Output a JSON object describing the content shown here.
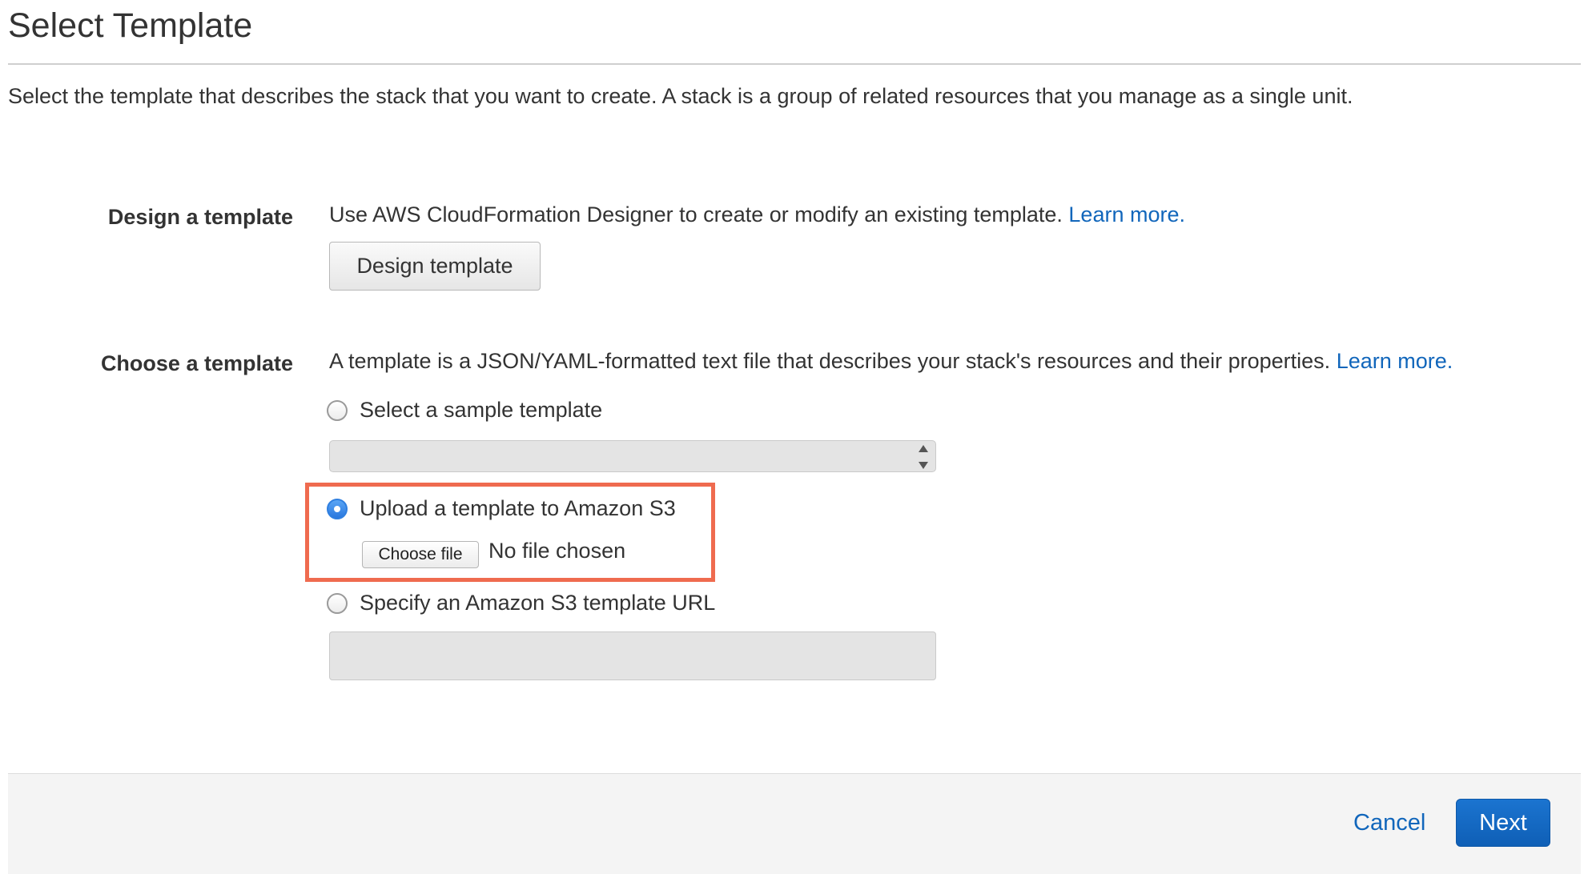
{
  "header": {
    "title": "Select Template",
    "description": "Select the template that describes the stack that you want to create. A stack is a group of related resources that you manage as a single unit."
  },
  "design_section": {
    "label": "Design a template",
    "text": "Use AWS CloudFormation Designer to create or modify an existing template. ",
    "link": "Learn more.",
    "button": "Design template"
  },
  "choose_section": {
    "label": "Choose a template",
    "text": "A template is a JSON/YAML-formatted text file that describes your stack's resources and their properties. ",
    "link": "Learn more.",
    "options": {
      "sample": "Select a sample template",
      "upload": "Upload a template to Amazon S3",
      "url": "Specify an Amazon S3 template URL"
    },
    "selected_option": "upload",
    "sample_select_value": "",
    "file_button": "Choose file",
    "file_status": "No file chosen",
    "url_value": ""
  },
  "footer": {
    "cancel": "Cancel",
    "next": "Next"
  },
  "colors": {
    "link": "#1166bb",
    "highlight": "#ef6b4f",
    "primary": "#1b74d0"
  }
}
